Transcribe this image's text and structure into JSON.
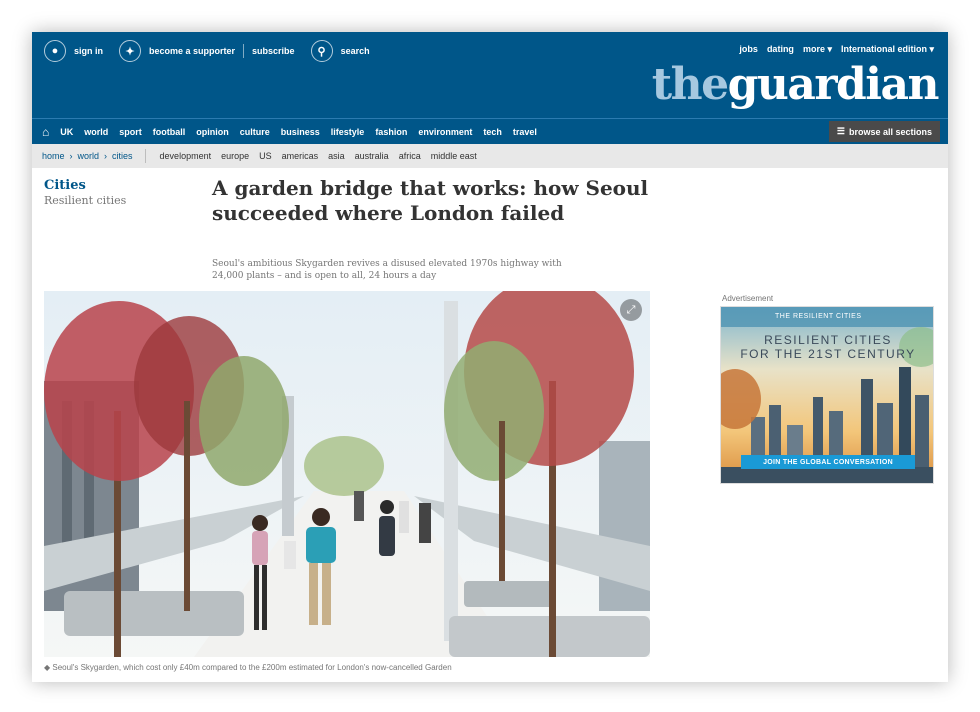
{
  "topbar": {
    "sign_in": "sign in",
    "become_supporter": "become a supporter",
    "subscribe": "subscribe",
    "search": "search"
  },
  "top_right_links": [
    "jobs",
    "dating",
    "more ▾",
    "International edition ▾"
  ],
  "logo": {
    "the": "the",
    "guardian": "guardian"
  },
  "nav": {
    "items": [
      "UK",
      "world",
      "sport",
      "football",
      "opinion",
      "culture",
      "business",
      "lifestyle",
      "fashion",
      "environment",
      "tech",
      "travel"
    ],
    "browse_label": "browse all sections"
  },
  "breadcrumb": [
    "home",
    "world",
    "cities"
  ],
  "subsections": [
    "development",
    "europe",
    "US",
    "americas",
    "asia",
    "australia",
    "africa",
    "middle east"
  ],
  "article": {
    "section": "Cities",
    "series": "Resilient cities",
    "headline_line1": "A garden bridge that works: how Seoul",
    "headline_line2": "succeeded where London failed",
    "standfirst_line1": "Seoul's ambitious Skygarden revives a disused elevated 1970s highway with",
    "standfirst_line2": "24,000 plants – and is open to all, 24 hours a day",
    "caption": "Seoul's Skygarden, which cost only £40m compared to the £200m estimated for London's now-cancelled Garden"
  },
  "ad": {
    "label": "Advertisement",
    "kicker": "THE RESILIENT CITIES",
    "title_line1": "RESILIENT CITIES",
    "title_line2": "FOR THE 21ST CENTURY",
    "cta": "JOIN THE GLOBAL CONVERSATION"
  },
  "colors": {
    "brand_blue": "#005689",
    "logo_the": "#a6c8e0",
    "ad_cta": "#1a9ad6"
  },
  "icons": [
    "user-icon",
    "supporter-icon",
    "search-icon",
    "home-icon",
    "menu-icon",
    "expand-icon"
  ]
}
